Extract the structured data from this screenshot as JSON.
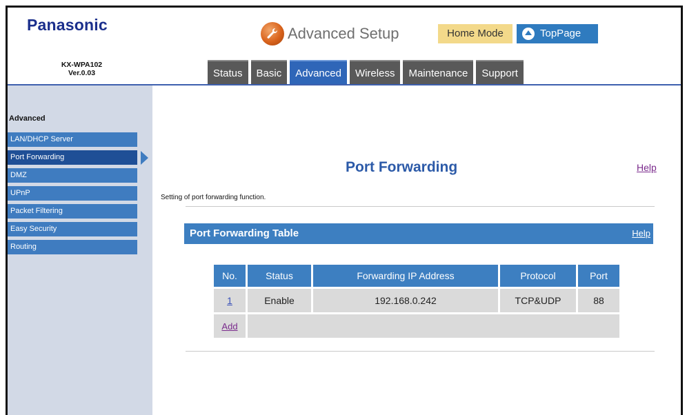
{
  "header": {
    "brand": "Panasonic",
    "model": "KX-WPA102",
    "version": "Ver.0.03",
    "setup_title": "Advanced Setup",
    "home_mode": "Home Mode",
    "toppage": "TopPage"
  },
  "tabs": [
    {
      "label": "Status"
    },
    {
      "label": "Basic"
    },
    {
      "label": "Advanced",
      "active": true
    },
    {
      "label": "Wireless"
    },
    {
      "label": "Maintenance"
    },
    {
      "label": "Support"
    }
  ],
  "sidebar": {
    "title": "Advanced",
    "items": [
      {
        "label": "LAN/DHCP Server"
      },
      {
        "label": "Port Forwarding",
        "active": true
      },
      {
        "label": "DMZ"
      },
      {
        "label": "UPnP"
      },
      {
        "label": "Packet Filtering"
      },
      {
        "label": "Easy Security"
      },
      {
        "label": "Routing"
      }
    ]
  },
  "main": {
    "title": "Port Forwarding",
    "help": "Help",
    "description": "Setting of port forwarding function.",
    "table_title": "Port Forwarding Table",
    "table_help": "Help",
    "columns": [
      "No.",
      "Status",
      "Forwarding IP Address",
      "Protocol",
      "Port"
    ],
    "rows": [
      {
        "no": "1",
        "status": "Enable",
        "ip": "192.168.0.242",
        "protocol": "TCP&UDP",
        "port": "88"
      }
    ],
    "add_label": "Add"
  },
  "colors": {
    "accent_blue": "#3d7fc1",
    "active_tab": "#2f66b8",
    "sidebar_bg": "#d2d9e6",
    "brand": "#1b2f8c",
    "home_mode_bg": "#f3d98a"
  }
}
